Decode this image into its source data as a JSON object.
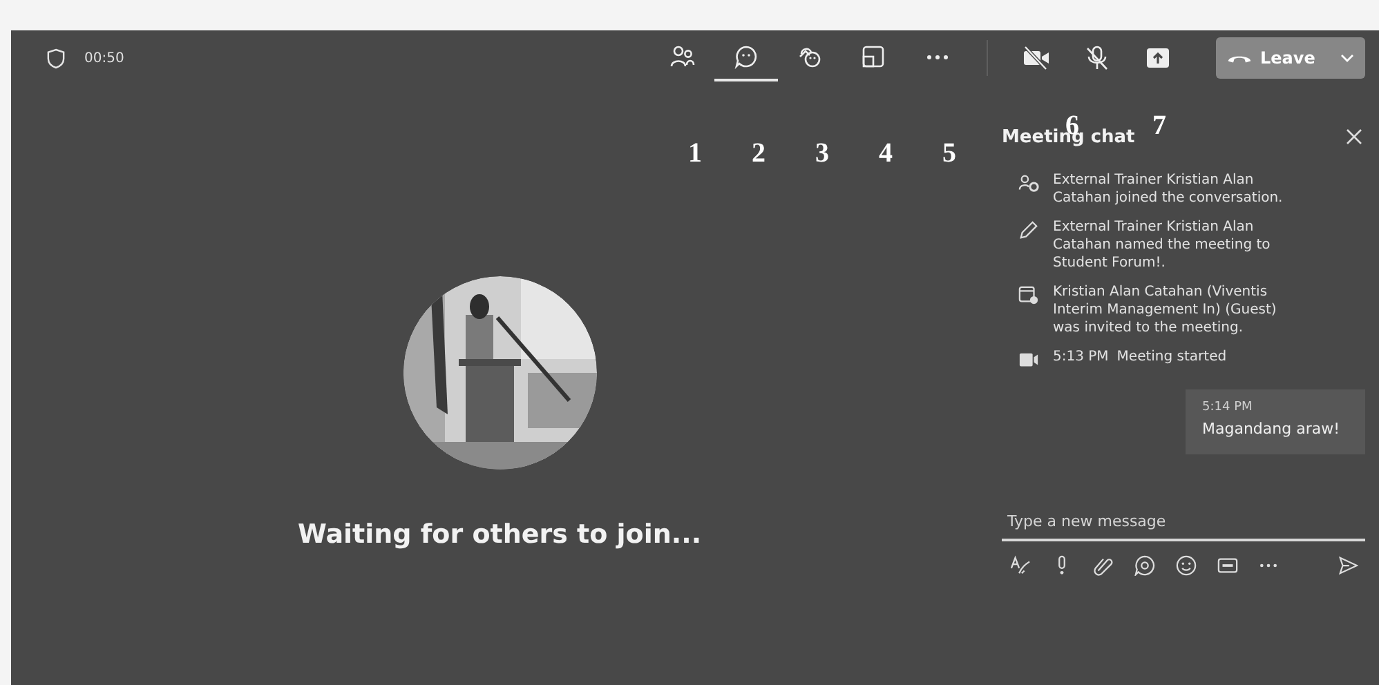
{
  "header": {
    "timer": "00:50"
  },
  "toolbar": [
    {
      "kind": "people",
      "selected": false
    },
    {
      "kind": "chat",
      "selected": true
    },
    {
      "kind": "reactions",
      "selected": false
    },
    {
      "kind": "view",
      "selected": false
    },
    {
      "kind": "more",
      "selected": false
    }
  ],
  "device_controls": [
    {
      "kind": "camera_off"
    },
    {
      "kind": "mic_off"
    },
    {
      "kind": "share"
    }
  ],
  "leave_button": {
    "label": "Leave"
  },
  "annotations": [
    "1",
    "2",
    "3",
    "4",
    "5",
    "6",
    "7"
  ],
  "stage": {
    "status": "Waiting for others to join..."
  },
  "chat": {
    "title": "Meeting chat",
    "events": [
      {
        "kind": "joined",
        "text": "External Trainer Kristian Alan Catahan joined the conversation."
      },
      {
        "kind": "renamed",
        "text": "External Trainer Kristian Alan Catahan named the meeting to Student Forum!."
      },
      {
        "kind": "invited",
        "text": "Kristian Alan Catahan (Viventis Interim Management In) (Guest) was invited to the meeting."
      },
      {
        "kind": "started",
        "time": "5:13 PM",
        "text": "Meeting started"
      }
    ],
    "messages": [
      {
        "time": "5:14 PM",
        "text": "Magandang araw!"
      }
    ],
    "composer": {
      "placeholder": "Type a new message"
    },
    "composer_tools": [
      {
        "kind": "format"
      },
      {
        "kind": "priority"
      },
      {
        "kind": "attach"
      },
      {
        "kind": "loop"
      },
      {
        "kind": "emoji"
      },
      {
        "kind": "gif"
      },
      {
        "kind": "more"
      },
      {
        "kind": "send"
      }
    ]
  }
}
